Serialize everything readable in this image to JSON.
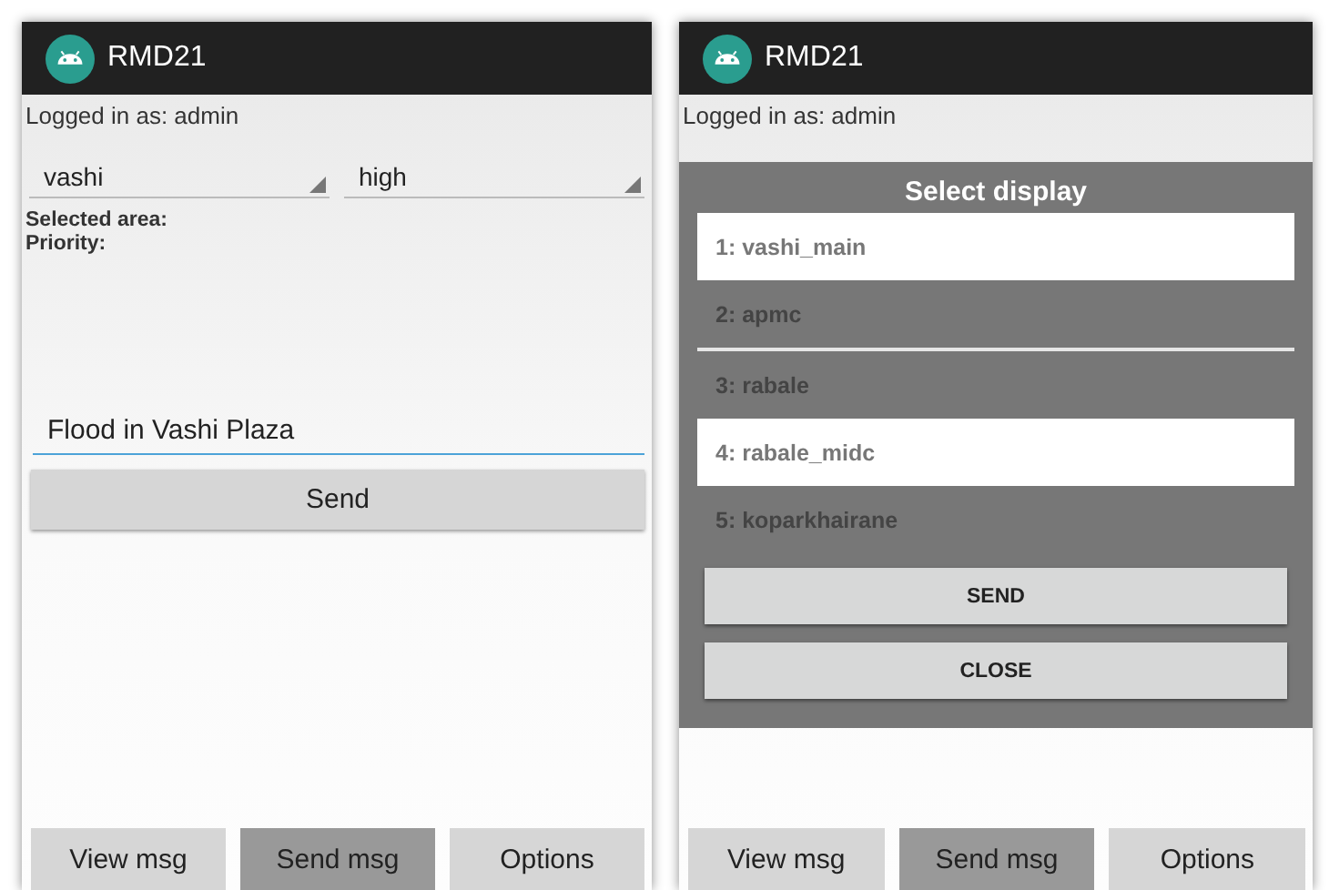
{
  "left_screen": {
    "title": "RMD21",
    "logged_in": "Logged in as: admin",
    "spinners": [
      "vashi",
      "high"
    ],
    "labels": [
      "Selected area:",
      "Priority:"
    ],
    "message_field": {
      "value": "Flood in Vashi Plaza"
    },
    "send_button": "Send",
    "nav": [
      {
        "label": "View msg",
        "selected": false
      },
      {
        "label": "Send msg",
        "selected": true
      },
      {
        "label": "Options",
        "selected": false
      }
    ]
  },
  "right_screen": {
    "title": "RMD21",
    "logged_in": "Logged in as: admin",
    "dialog": {
      "title": "Select display",
      "items": [
        {
          "label": "1: vashi_main",
          "selected": true
        },
        {
          "label": "2: apmc",
          "selected": false
        },
        {
          "label": "3: rabale",
          "selected": false
        },
        {
          "label": "4: rabale_midc",
          "selected": true
        },
        {
          "label": "5: koparkhairane",
          "selected": false
        }
      ],
      "buttons": [
        "SEND",
        "CLOSE"
      ]
    },
    "nav": [
      {
        "label": "View msg",
        "selected": false
      },
      {
        "label": "Send msg",
        "selected": true
      },
      {
        "label": "Options",
        "selected": false
      }
    ]
  }
}
